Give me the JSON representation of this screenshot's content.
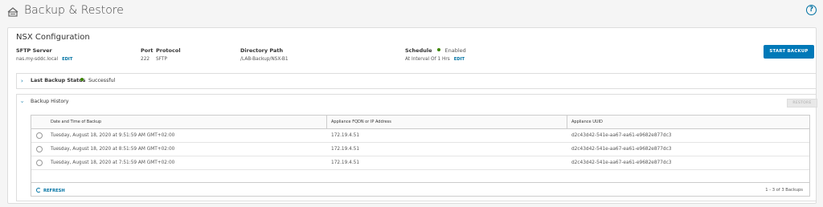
{
  "header": {
    "title": "Backup & Restore",
    "help_glyph": "?"
  },
  "config": {
    "title": "NSX Configuration",
    "sftp_server_label": "SFTP Server",
    "sftp_server_value": "nas.my-sddc.local",
    "sftp_edit": "EDIT",
    "port_label": "Port",
    "port_value": "222",
    "protocol_label": "Protocol",
    "protocol_value": "SFTP",
    "directory_label": "Directory Path",
    "directory_value": "/LAB-Backup/NSX-B1",
    "schedule_label": "Schedule",
    "schedule_status": "Enabled",
    "schedule_value": "At Interval Of 1 Hrs",
    "schedule_edit": "EDIT",
    "start_backup": "START BACKUP"
  },
  "last_backup": {
    "label": "Last Backup Status",
    "status": "Successful"
  },
  "history": {
    "label": "Backup History",
    "restore": "RESTORE",
    "columns": [
      "Date and Time of Backup",
      "Appliance FQDN or IP Address",
      "Appliance UUID"
    ],
    "rows": [
      {
        "date": "Tuesday, August 18, 2020 at 9:51:59 AM GMT+02:00",
        "ip": "172.19.4.51",
        "uuid": "d2c43d42-541e-aa67-ea61-e9682e877dc3"
      },
      {
        "date": "Tuesday, August 18, 2020 at 8:51:59 AM GMT+02:00",
        "ip": "172.19.4.51",
        "uuid": "d2c43d42-541e-aa67-ea61-e9682e877dc3"
      },
      {
        "date": "Tuesday, August 18, 2020 at 7:51:59 AM GMT+02:00",
        "ip": "172.19.4.51",
        "uuid": "d2c43d42-541e-aa67-ea61-e9682e877dc3"
      }
    ],
    "refresh": "REFRESH",
    "pagination": "1 - 3 of 3 Backups"
  },
  "colors": {
    "accent": "#0072a3",
    "primary_button": "#0079b8",
    "success": "#3c8500"
  },
  "icons": {
    "header": "backup-restore-icon",
    "help": "help-icon",
    "refresh": "refresh-icon",
    "chevron_collapsed": "chevron-right-icon",
    "chevron_expanded": "chevron-down-icon"
  }
}
